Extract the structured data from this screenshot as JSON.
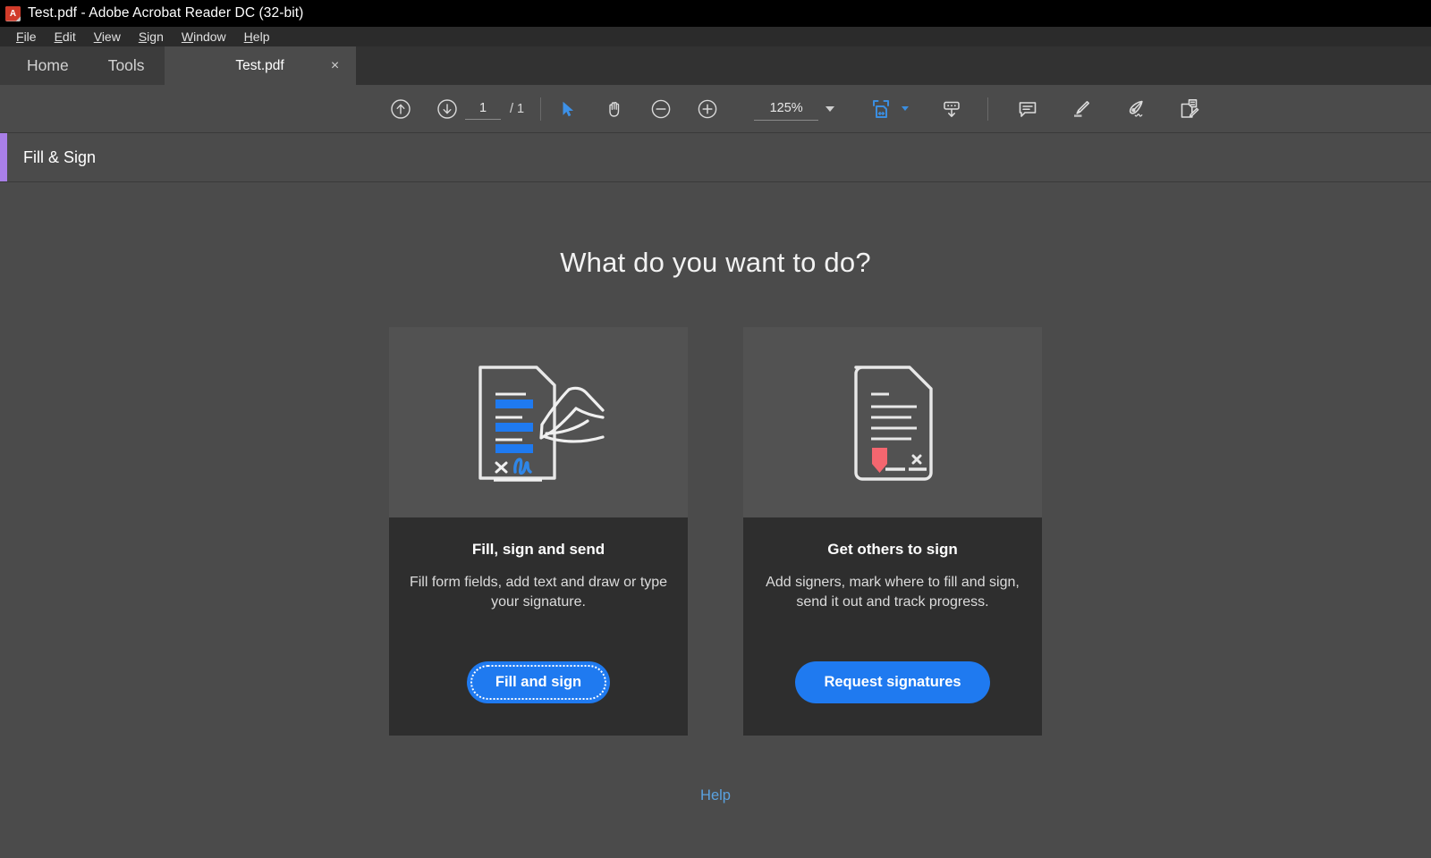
{
  "window": {
    "title": "Test.pdf - Adobe Acrobat Reader DC (32-bit)",
    "app_icon": "acrobat-icon"
  },
  "menubar": {
    "items": [
      {
        "label": "File",
        "mnemonic": "F",
        "rest": "ile"
      },
      {
        "label": "Edit",
        "mnemonic": "E",
        "rest": "dit"
      },
      {
        "label": "View",
        "mnemonic": "V",
        "rest": "iew"
      },
      {
        "label": "Sign",
        "mnemonic": "S",
        "rest": "ign"
      },
      {
        "label": "Window",
        "mnemonic": "W",
        "rest": "indow"
      },
      {
        "label": "Help",
        "mnemonic": "H",
        "rest": "elp"
      }
    ]
  },
  "tabbar": {
    "home_label": "Home",
    "tools_label": "Tools",
    "document_tab_label": "Test.pdf",
    "close_glyph": "×"
  },
  "toolbar": {
    "previous_page_icon": "arrow-up-circle-icon",
    "next_page_icon": "arrow-down-circle-icon",
    "page_number": "1",
    "page_total": "/ 1",
    "select_tool_icon": "cursor-arrow-icon",
    "hand_tool_icon": "hand-icon",
    "zoom_out_icon": "minus-circle-icon",
    "zoom_in_icon": "plus-circle-icon",
    "zoom_level": "125%",
    "zoom_dropdown_icon": "chevron-down-icon",
    "fit_page_icon": "fit-page-icon",
    "fit_page_dropdown_icon": "chevron-down-icon",
    "page_display_icon": "scroll-page-down-icon",
    "comment_icon": "comment-icon",
    "highlight_icon": "highlighter-icon",
    "sign_icon": "fountain-pen-icon",
    "fill_sign_icon": "fill-and-sign-icon"
  },
  "fill_sign_bar": {
    "title": "Fill & Sign",
    "accent_color": "#a97fe8"
  },
  "main": {
    "headline": "What do you want to do?",
    "cards": [
      {
        "illustration": "document-with-pen-signing-icon",
        "title": "Fill, sign and send",
        "description": "Fill form fields, add text and draw or type your signature.",
        "button_label": "Fill and sign",
        "button_focused": true
      },
      {
        "illustration": "document-with-signature-tag-icon",
        "title": "Get others to sign",
        "description": "Add signers, mark where to fill and sign, send it out and track progress.",
        "button_label": "Request signatures",
        "button_focused": false
      }
    ],
    "help_link": "Help"
  },
  "colors": {
    "accent_blue": "#1f7af0",
    "link_blue": "#5aa2e0",
    "purple_accent": "#a97fe8",
    "red_tag": "#f4666f",
    "page_background": "#4b4b4b",
    "card_body": "#2e2e2e"
  }
}
